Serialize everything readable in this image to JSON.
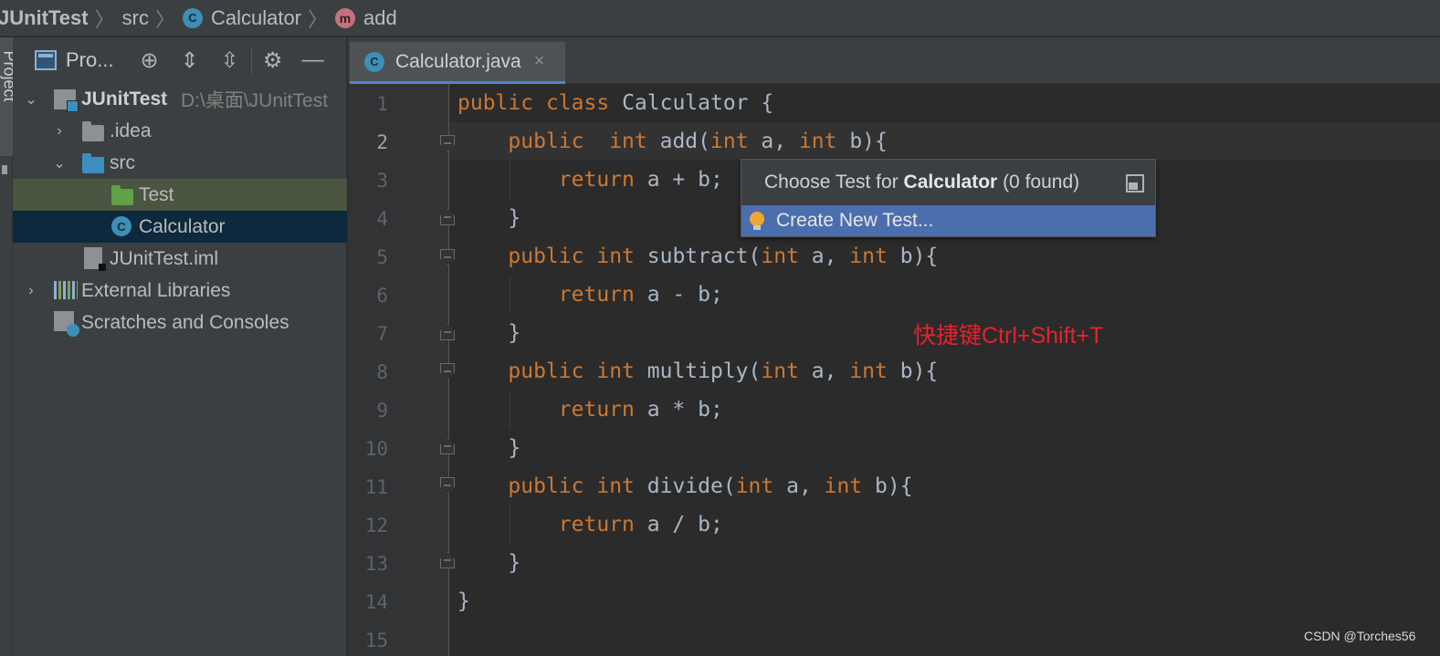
{
  "breadcrumb": {
    "project": "JUnitTest",
    "folder": "src",
    "class": "Calculator",
    "method": "add",
    "class_badge": "C",
    "method_badge": "m"
  },
  "left_strip": {
    "tab_label": "Project"
  },
  "project_panel": {
    "title": "Pro...",
    "toolbar_icons": [
      "locate-icon",
      "expand-all-icon",
      "collapse-all-icon",
      "gear-icon",
      "minimize-icon"
    ],
    "tree": [
      {
        "label": "JUnitTest",
        "hint": "D:\\桌面\\JUnitTest",
        "expanded": true,
        "icon": "module-icon"
      },
      {
        "label": ".idea",
        "expanded": false,
        "icon": "folder-icon"
      },
      {
        "label": "src",
        "expanded": true,
        "icon": "folder-icon"
      },
      {
        "label": "Test",
        "icon": "test-folder-icon"
      },
      {
        "label": "Calculator",
        "icon": "class-icon",
        "badge": "C"
      },
      {
        "label": "JUnitTest.iml",
        "icon": "file-icon"
      },
      {
        "label": "External Libraries",
        "expanded": false,
        "icon": "library-icon"
      },
      {
        "label": "Scratches and Consoles",
        "icon": "scratches-icon"
      }
    ]
  },
  "editor": {
    "tab": {
      "label": "Calculator.java",
      "badge": "C",
      "close": "×"
    },
    "active_line": 2,
    "line_numbers": [
      "1",
      "2",
      "3",
      "4",
      "5",
      "6",
      "7",
      "8",
      "9",
      "10",
      "11",
      "12",
      "13",
      "14",
      "15"
    ],
    "code": {
      "l1": {
        "k1": "public",
        "k2": "class",
        "name": "Calculator",
        "rest": " {"
      },
      "l2": {
        "k1": "public",
        "k2": "int",
        "name": "add",
        "p1": "int",
        "a": " a, ",
        "p2": "int",
        "b": " b){"
      },
      "l3": {
        "k": "return",
        "rest": " a + b;"
      },
      "l4": {
        "rest": "}"
      },
      "l5": {
        "k1": "public",
        "k2": "int",
        "name": "subtract",
        "p1": "int",
        "a": " a, ",
        "p2": "int",
        "b": " b){"
      },
      "l6": {
        "k": "return",
        "rest": " a - b;"
      },
      "l7": {
        "rest": "}"
      },
      "l8": {
        "k1": "public",
        "k2": "int",
        "name": "multiply",
        "p1": "int",
        "a": " a, ",
        "p2": "int",
        "b": " b){"
      },
      "l9": {
        "k": "return",
        "rest": " a * b;"
      },
      "l10": {
        "rest": "}"
      },
      "l11": {
        "k1": "public",
        "k2": "int",
        "name": "divide",
        "p1": "int",
        "a": " a, ",
        "p2": "int",
        "b": " b){"
      },
      "l12": {
        "k": "return",
        "rest": " a / b;"
      },
      "l13": {
        "rest": "}"
      },
      "l14": {
        "rest": "}"
      }
    }
  },
  "popup": {
    "title_prefix": "Choose Test for ",
    "title_class": "Calculator",
    "title_suffix": " (0 found)",
    "item_label": "Create New Test..."
  },
  "annotation": "快捷键Ctrl+Shift+T",
  "watermark": "CSDN @Torches56",
  "colors": {
    "keyword": "#cc7832",
    "text": "#a9b7c6",
    "selection": "#4b6eaf",
    "annotation": "#e8212d"
  }
}
